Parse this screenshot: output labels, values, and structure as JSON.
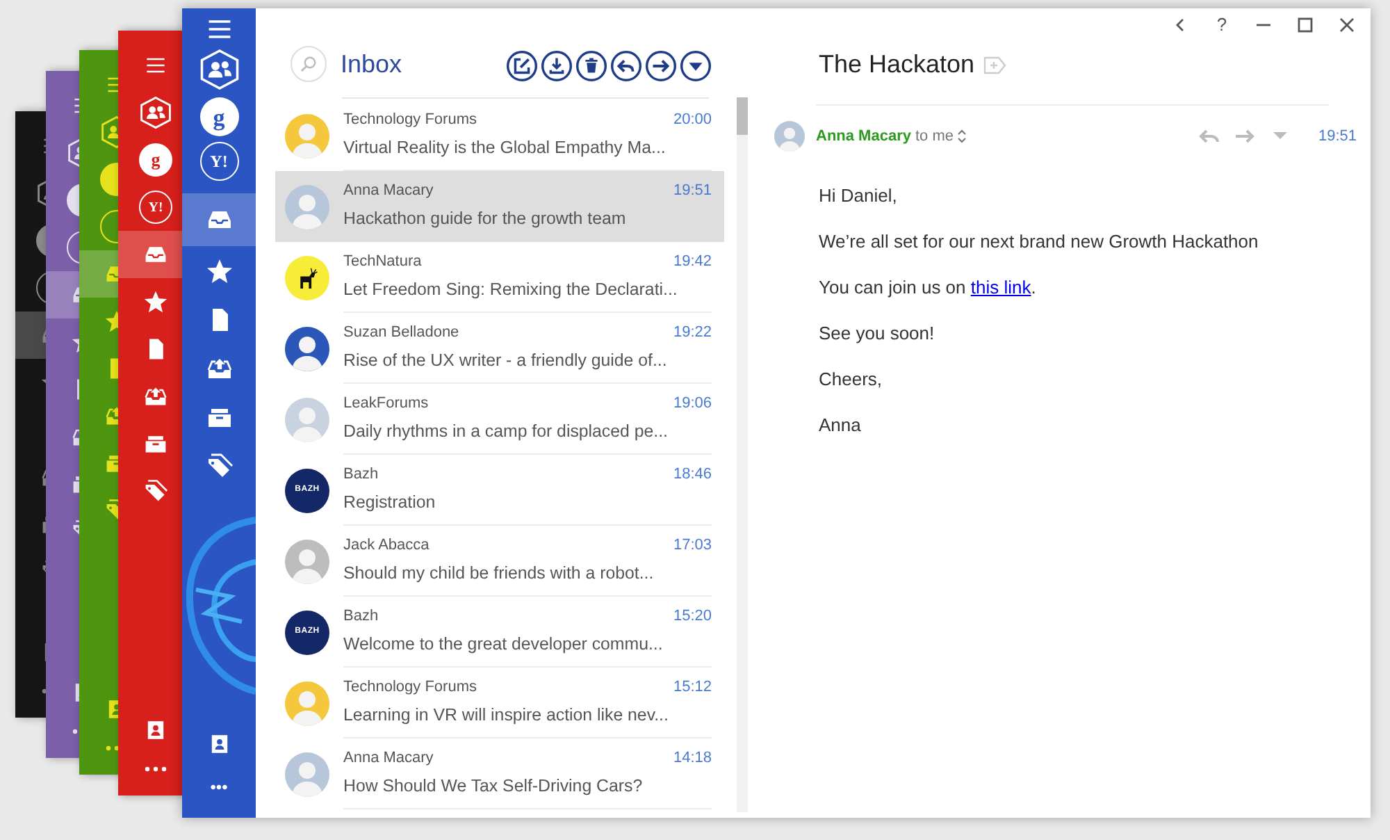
{
  "themes": [
    {
      "color": "#161616"
    },
    {
      "color": "#7b5fa9"
    },
    {
      "color": "#4f9610"
    },
    {
      "color": "#d71f1b",
      "labels": [
        "g",
        "Y!"
      ]
    }
  ],
  "sidebar": {
    "color": "#2b55c2",
    "accounts": [
      {
        "kind": "people"
      },
      {
        "kind": "google",
        "label": "g"
      },
      {
        "kind": "yahoo",
        "label": "Y!"
      }
    ],
    "folders": [
      {
        "kind": "inbox",
        "selected": true
      },
      {
        "kind": "star",
        "selected": false
      },
      {
        "kind": "drafts",
        "selected": false
      },
      {
        "kind": "sent",
        "selected": false
      },
      {
        "kind": "archive",
        "selected": false
      },
      {
        "kind": "tags",
        "selected": false
      }
    ],
    "more": "•••"
  },
  "inbox": {
    "title": "Inbox",
    "toolbar": [
      {
        "kind": "compose"
      },
      {
        "kind": "download"
      },
      {
        "kind": "trash"
      },
      {
        "kind": "reply"
      },
      {
        "kind": "forward"
      },
      {
        "kind": "dropdown"
      }
    ],
    "messages": [
      {
        "sender": "Technology Forums",
        "subject": "Virtual Reality is the Global Empathy Ma...",
        "time": "20:00",
        "selected": false,
        "avatar": {
          "kind": "silhouette",
          "color": "#f5c73c"
        }
      },
      {
        "sender": "Anna Macary",
        "subject": "Hackathon guide for the growth team",
        "time": "19:51",
        "selected": true,
        "avatar": {
          "kind": "silhouette",
          "color": "#b7c6d8"
        }
      },
      {
        "sender": "TechNatura",
        "subject": "Let Freedom Sing: Remixing the Declarati...",
        "time": "19:42",
        "selected": false,
        "avatar": {
          "kind": "deer",
          "color": "#f7ec37"
        }
      },
      {
        "sender": "Suzan Belladone",
        "subject": "Rise of the UX writer - a friendly guide of...",
        "time": "19:22",
        "selected": false,
        "avatar": {
          "kind": "silhouette",
          "color": "#2a57b8"
        }
      },
      {
        "sender": "LeakForums",
        "subject": "Daily rhythms in a camp for displaced pe...",
        "time": "19:06",
        "selected": false,
        "avatar": {
          "kind": "silhouette",
          "color": "#c9d3df"
        }
      },
      {
        "sender": "Bazh",
        "subject": "Registration",
        "time": "18:46",
        "selected": false,
        "avatar": {
          "kind": "logo",
          "color": "#142766",
          "text": "BAZH"
        }
      },
      {
        "sender": "Jack Abacca",
        "subject": "Should my child be friends with a robot...",
        "time": "17:03",
        "selected": false,
        "avatar": {
          "kind": "silhouette",
          "color": "#bdbdbd"
        }
      },
      {
        "sender": "Bazh",
        "subject": "Welcome to the great developer commu...",
        "time": "15:20",
        "selected": false,
        "avatar": {
          "kind": "logo",
          "color": "#142766",
          "text": "BAZH"
        }
      },
      {
        "sender": "Technology Forums",
        "subject": "Learning in VR will inspire action like nev...",
        "time": "15:12",
        "selected": false,
        "avatar": {
          "kind": "silhouette",
          "color": "#f5c73c"
        }
      },
      {
        "sender": "Anna Macary",
        "subject": "How Should We Tax Self-Driving Cars?",
        "time": "14:18",
        "selected": false,
        "avatar": {
          "kind": "silhouette",
          "color": "#b7c6d8"
        }
      }
    ]
  },
  "window_controls": [
    {
      "kind": "back"
    },
    {
      "kind": "help",
      "text": "?"
    },
    {
      "kind": "minimize"
    },
    {
      "kind": "maximize"
    },
    {
      "kind": "close"
    }
  ],
  "email": {
    "title": "The Hackaton",
    "sender": "Anna Macary",
    "recipient": "to me",
    "time": "19:51",
    "avatar": {
      "kind": "silhouette",
      "color": "#b7c6d8"
    },
    "body": [
      {
        "text": "Hi Daniel,"
      },
      {
        "text": "We’re all set for our next brand new Growth Hackathon"
      },
      {
        "text": "You can join us on ",
        "link": "this link",
        "after": "."
      },
      {
        "text": "See you soon!"
      },
      {
        "text": "Cheers,"
      },
      {
        "text": "Anna"
      }
    ]
  }
}
